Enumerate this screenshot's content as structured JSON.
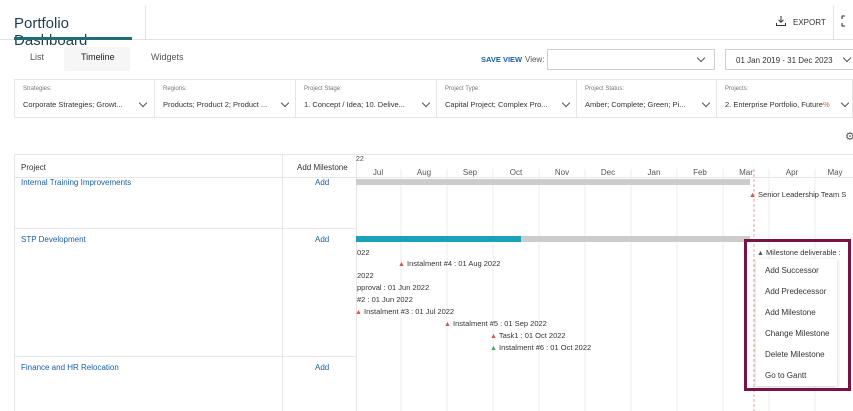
{
  "app": {
    "title": "Portfolio Dashboard",
    "export_label": "EXPORT"
  },
  "view_tabs": {
    "list": "List",
    "timeline": "Timeline",
    "widgets": "Widgets"
  },
  "toolbar": {
    "save_view": "SAVE VIEW",
    "view_label": "View:",
    "view_value": "",
    "date_range": "01 Jan 2019 - 31 Dec 2023"
  },
  "filters": [
    {
      "label": "Strategies:",
      "value": "Corporate Strategies; Growt..."
    },
    {
      "label": "Regions:",
      "value": "Products; Product 2; Product ..."
    },
    {
      "label": "Project Stage:",
      "value": "1. Concept / Idea; 10. Delive..."
    },
    {
      "label": "Project Type:",
      "value": "Capital Project; Complex Pro..."
    },
    {
      "label": "Project Status:",
      "value": "Amber; Complete; Green; Pi..."
    },
    {
      "label": "Projects:",
      "value": "2. Enterprise Portfolio, Future",
      "value_suffix": "%"
    }
  ],
  "grid": {
    "col_project": "Project",
    "col_add_milestone": "Add Milestone",
    "year_fragment": "22",
    "months": [
      "Jul",
      "Aug",
      "Sep",
      "Oct",
      "Nov",
      "Dec",
      "Jan",
      "Feb",
      "Mar",
      "Apr",
      "May"
    ]
  },
  "projects": [
    {
      "name": "Internal Training Improvements",
      "add": "Add"
    },
    {
      "name": "STP Development",
      "add": "Add"
    },
    {
      "name": "Finance and HR Relocation",
      "add": "Add"
    }
  ],
  "milestones": {
    "senior_leadership": "Senior Leadership Team S",
    "m022": "022",
    "instalment4": "Instalment #4 : 01 Aug 2022",
    "m2022": "2022",
    "approval": "pproval : 01 Jun 2022",
    "m2": "#2 : 01 Jun 2022",
    "instalment3": "Instalment #3 : 01 Jul 2022",
    "instalment5": "Instalment #5 : 01 Sep 2022",
    "task1": "Task1 : 01 Oct 2022",
    "instalment6": "Instalment #6 : 01 Oct 2022"
  },
  "context_menu": {
    "header": "Milestone deliverable :",
    "items": [
      "Add Successor",
      "Add Predecessor",
      "Add Milestone",
      "Change Milestone",
      "Delete Milestone",
      "Go to Gantt"
    ]
  },
  "colors": {
    "accent": "#1e6e76",
    "link": "#1a5fa7",
    "bar_progress": "#1aa3b8",
    "bar_rest": "#cccccc",
    "milestone_red": "#d9534f",
    "milestone_green": "#3ea55f",
    "highlight_frame": "#7b1245",
    "today_line": "#e8a0a0"
  }
}
